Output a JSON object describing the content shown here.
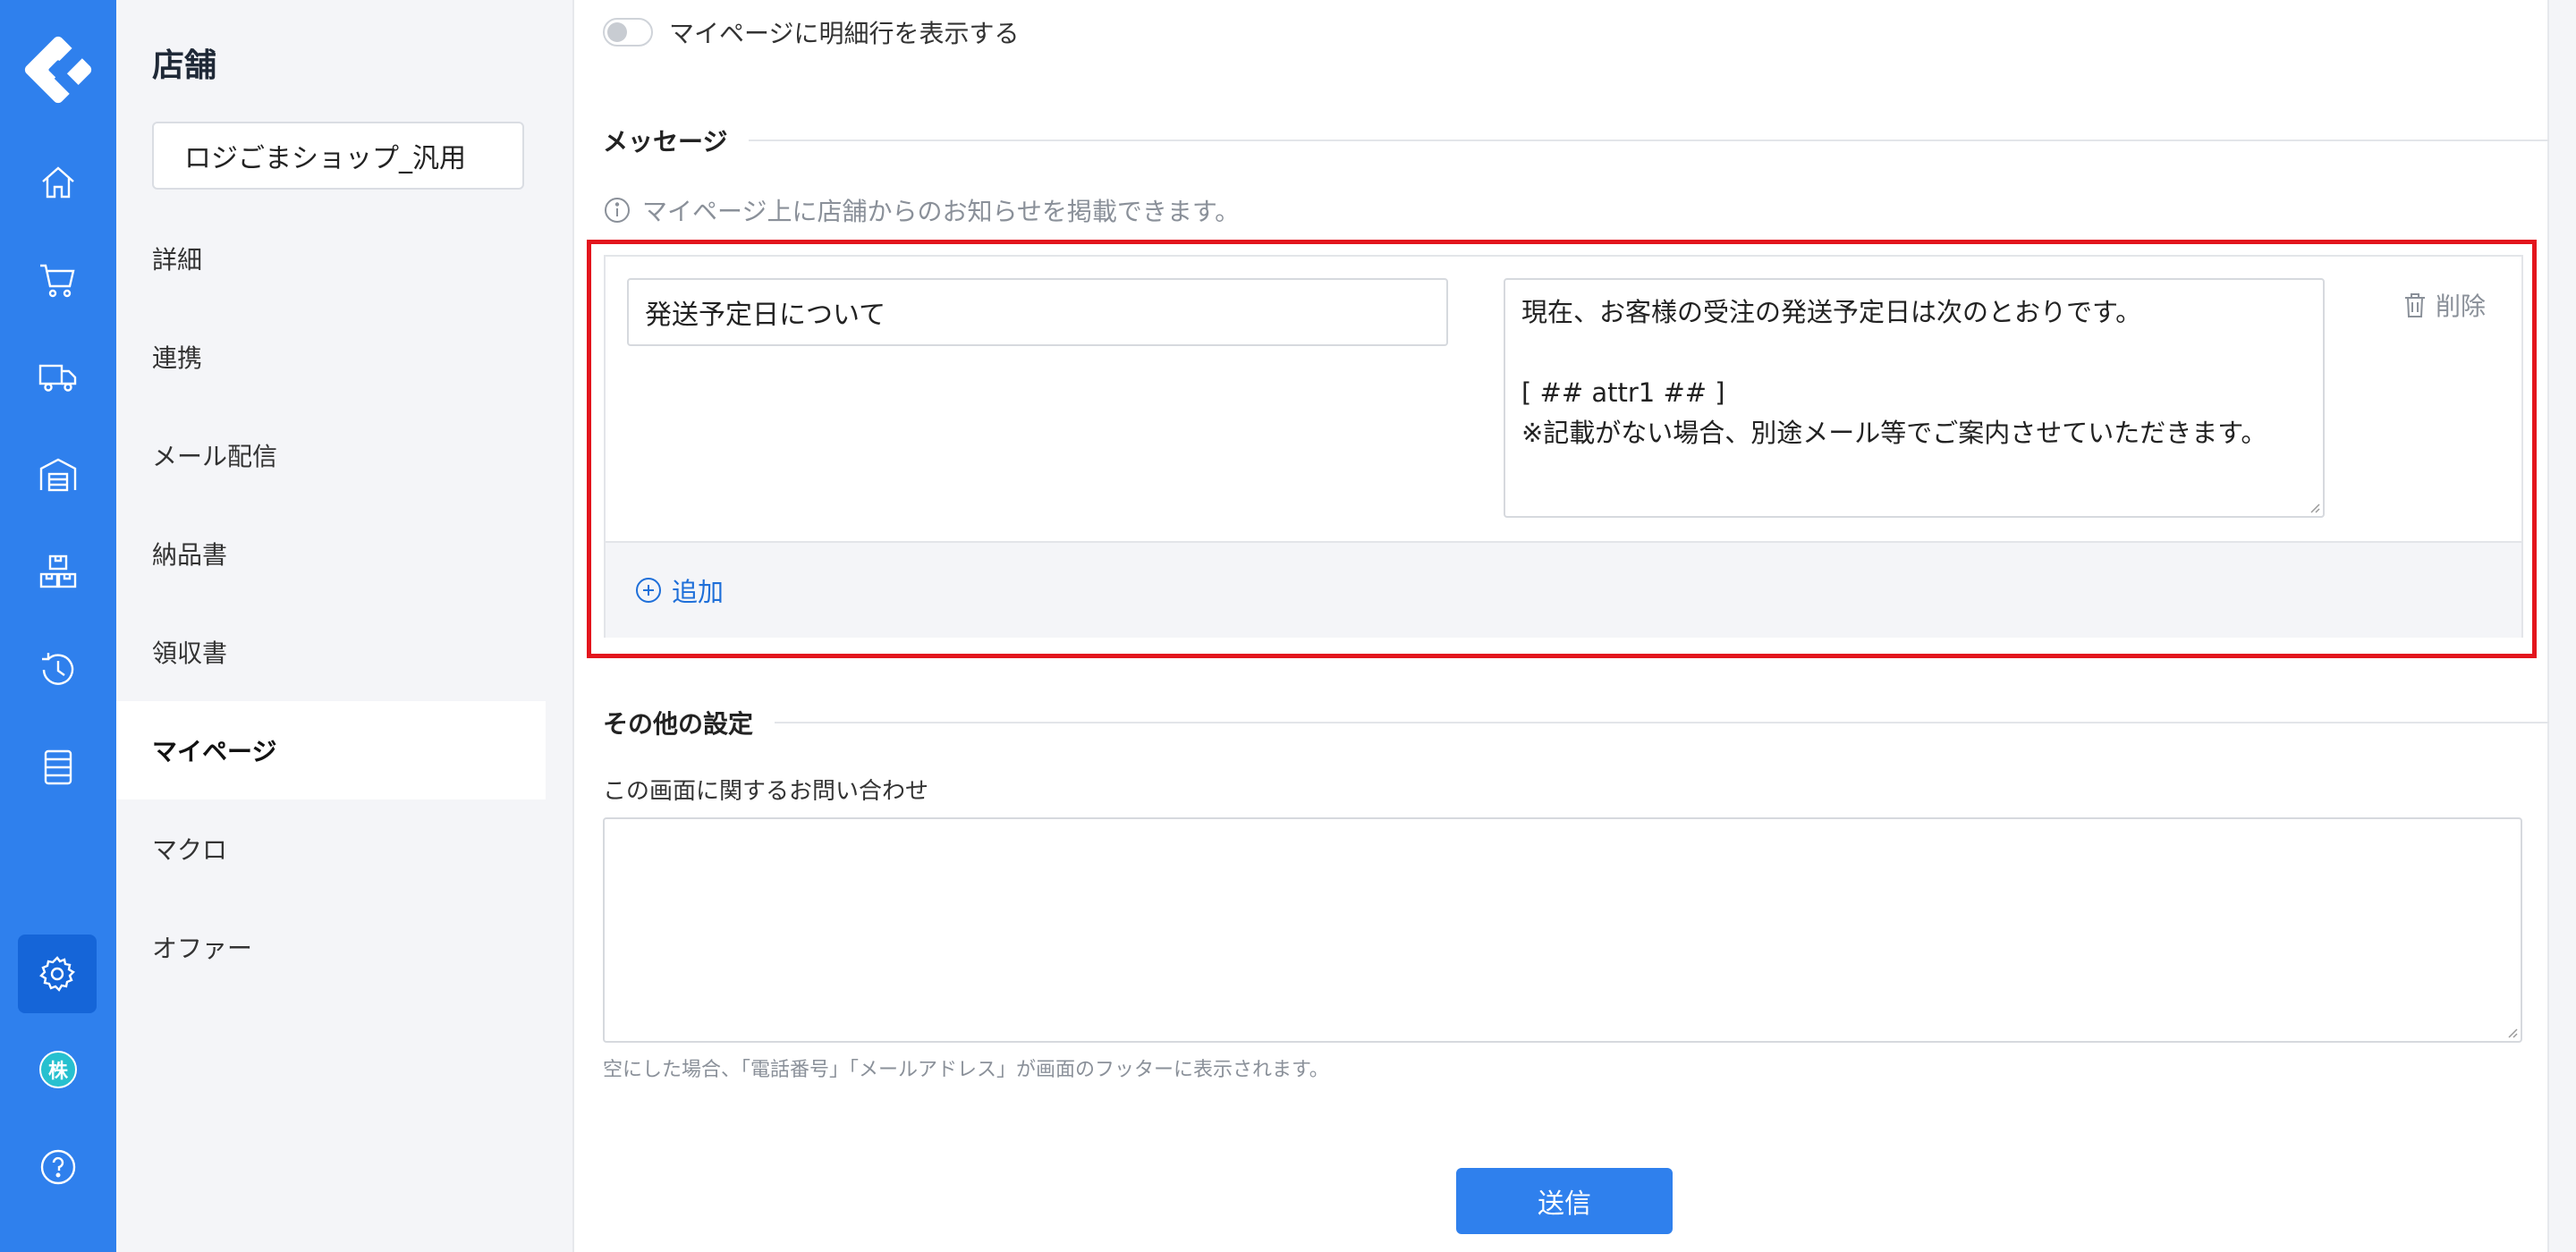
{
  "rail": {
    "items": [
      "home-icon",
      "cart-icon",
      "truck-icon",
      "warehouse-icon",
      "boxes-icon",
      "history-icon",
      "document-icon",
      "gear-icon",
      "company-badge",
      "help-icon"
    ],
    "badge_label": "株",
    "help_label": "?"
  },
  "sidebar": {
    "title": "店舗",
    "shop_name": "ロジごまショップ_汎用",
    "items": [
      {
        "label": "詳細"
      },
      {
        "label": "連携"
      },
      {
        "label": "メール配信"
      },
      {
        "label": "納品書"
      },
      {
        "label": "領収書"
      },
      {
        "label": "マイページ"
      },
      {
        "label": "マクロ"
      },
      {
        "label": "オファー"
      }
    ],
    "active_item": "マイページ"
  },
  "main": {
    "toggle_label": "マイページに明細行を表示する",
    "message_section": {
      "heading": "メッセージ",
      "hint": "マイページ上に店舗からのお知らせを掲載できます。",
      "title_value": "発送予定日について",
      "body_lines": [
        "現在、お客様の受注の発送予定日は次のとおりです。",
        "",
        "[ ## attr1 ## ]",
        "※記載がない場合、別途メール等でご案内させていただきます。"
      ],
      "delete_label": "削除",
      "add_label": "追加"
    },
    "other_section": {
      "heading": "その他の設定",
      "contact_label": "この画面に関するお問い合わせ",
      "contact_value": "",
      "help_text": "空にした場合、「電話番号」「メールアドレス」が画面のフッターに表示されます。"
    },
    "submit_label": "送信"
  },
  "colors": {
    "rail": "#2f80ed",
    "rail_active": "#1565d8",
    "highlight_border": "#e3151d",
    "link": "#1e6fd9"
  }
}
